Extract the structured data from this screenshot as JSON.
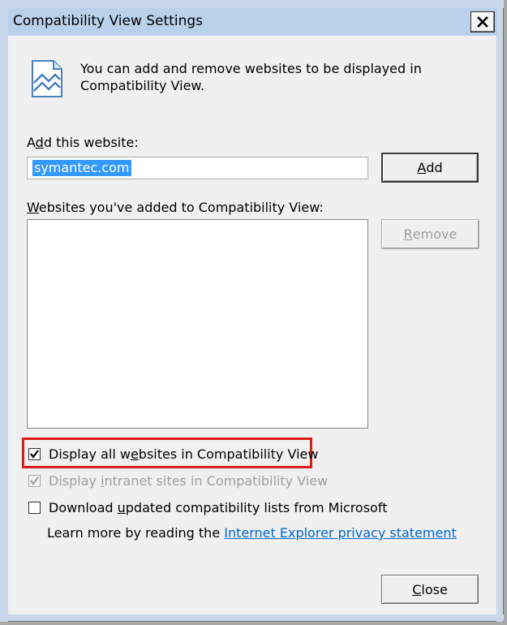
{
  "window": {
    "title": "Compatibility View Settings"
  },
  "intro": {
    "text": "You can add and remove websites to be displayed in Compatibility View."
  },
  "add_site": {
    "label_pre": "A",
    "label_ul": "d",
    "label_post": "d this website:",
    "value": "symantec.com",
    "add_button_ul": "A",
    "add_button_rest": "dd"
  },
  "list": {
    "label_ul": "W",
    "label_rest": "ebsites you've added to Compatibility View:",
    "remove_button_ul": "R",
    "remove_button_rest": "emove",
    "items": []
  },
  "options": {
    "display_all": {
      "pre": "Display all w",
      "ul": "e",
      "post": "bsites in Compatibility View",
      "checked": true,
      "enabled": true
    },
    "display_intranet": {
      "pre": "Display ",
      "ul": "i",
      "post": "ntranet sites in Compatibility View",
      "checked": true,
      "enabled": false
    },
    "download_lists": {
      "pre": "Download ",
      "ul": "u",
      "post": "pdated compatibility lists from Microsoft",
      "checked": false,
      "enabled": true
    }
  },
  "learn_more": {
    "text": "Learn more by reading the ",
    "link": "Internet Explorer privacy statement"
  },
  "close_button": {
    "ul": "C",
    "rest": "lose"
  },
  "colors": {
    "highlight": "#e11b1b",
    "link": "#0066cc",
    "selection": "#3399ff"
  }
}
